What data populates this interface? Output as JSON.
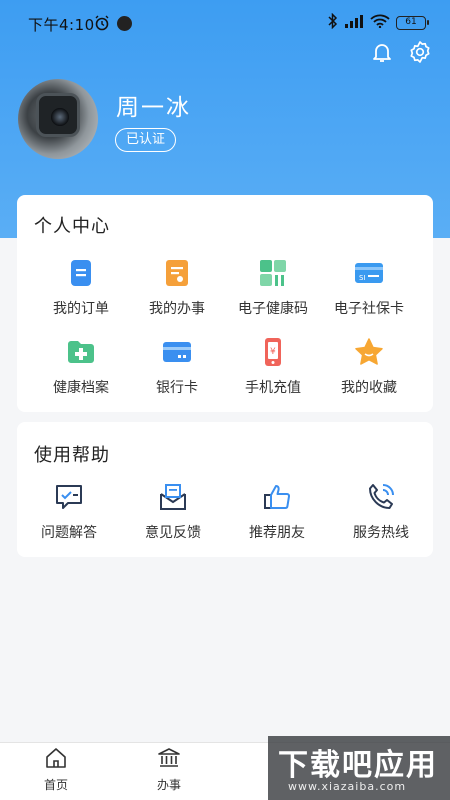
{
  "status_bar": {
    "time": "下午4:10",
    "battery": "61"
  },
  "profile": {
    "name": "周一冰",
    "verified_label": "已认证"
  },
  "personal_center": {
    "title": "个人中心",
    "items": [
      {
        "label": "我的订单",
        "icon": "order-icon",
        "color": "#3a8ff0"
      },
      {
        "label": "我的办事",
        "icon": "affairs-icon",
        "color": "#f5a03a"
      },
      {
        "label": "电子健康码",
        "icon": "health-code-icon",
        "color": "#4cc28a"
      },
      {
        "label": "电子社保卡",
        "icon": "social-security-card-icon",
        "color": "#3a9af0"
      },
      {
        "label": "健康档案",
        "icon": "health-record-icon",
        "color": "#4cc28a"
      },
      {
        "label": "银行卡",
        "icon": "bank-card-icon",
        "color": "#3a8ff0"
      },
      {
        "label": "手机充值",
        "icon": "phone-recharge-icon",
        "color": "#f0645a"
      },
      {
        "label": "我的收藏",
        "icon": "favorites-star-icon",
        "color": "#f7a733"
      }
    ]
  },
  "help": {
    "title": "使用帮助",
    "items": [
      {
        "label": "问题解答",
        "icon": "qa-icon"
      },
      {
        "label": "意见反馈",
        "icon": "feedback-mail-icon"
      },
      {
        "label": "推荐朋友",
        "icon": "thumbs-up-icon"
      },
      {
        "label": "服务热线",
        "icon": "hotline-phone-icon"
      }
    ]
  },
  "tabbar": [
    {
      "label": "首页",
      "icon": "home-icon"
    },
    {
      "label": "办事",
      "icon": "government-building-icon"
    }
  ],
  "watermark": {
    "text": "下载吧应用",
    "url": "www.xiazaiba.com"
  },
  "colors": {
    "header_blue": "#3d9df2",
    "card_bg": "#ffffff",
    "page_bg": "#f5f6f8"
  }
}
